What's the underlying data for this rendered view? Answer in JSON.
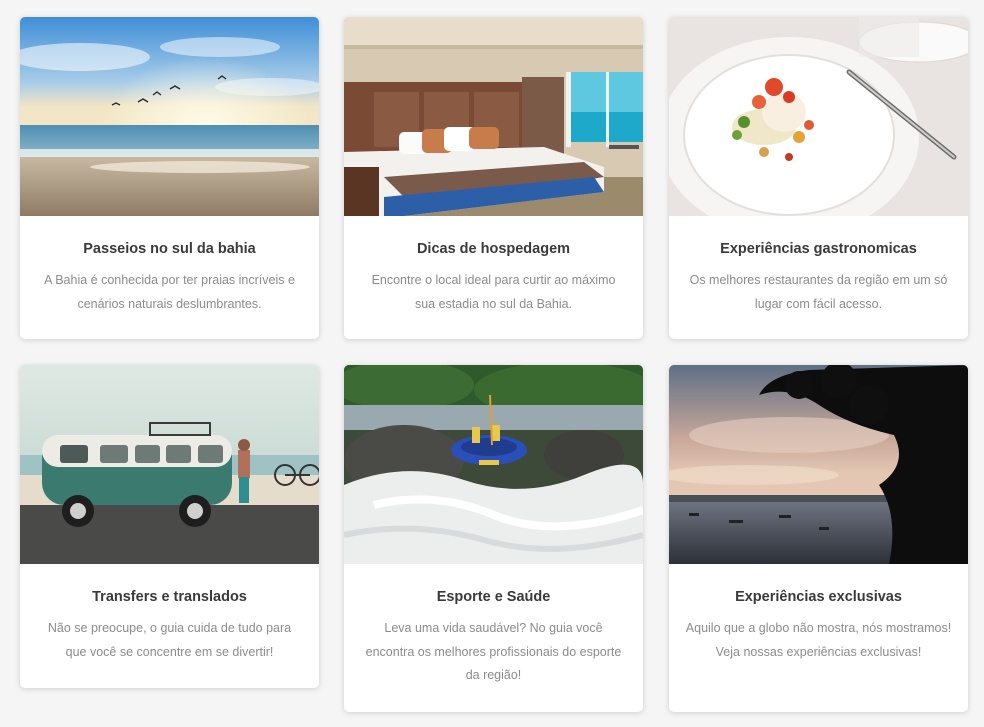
{
  "cards": [
    {
      "title": "Passeios no sul da bahia",
      "description": "A Bahia é conhecida por ter praias incríveis e cenários naturais deslumbrantes."
    },
    {
      "title": "Dicas de hospedagem",
      "description": "Encontre o local ideal para curtir ao máximo sua estadia no sul da Bahia."
    },
    {
      "title": "Experiências gastronomicas",
      "description": "Os melhores restaurantes da região em um só lugar com fácil acesso."
    },
    {
      "title": "Transfers e translados",
      "description": "Não se preocupe, o guia cuida de tudo para que você se concentre em se divertir!"
    },
    {
      "title": "Esporte e Saúde",
      "description": "Leva uma vida saudável? No guia você encontra os melhores profissionais do esporte da região!"
    },
    {
      "title": "Experiências exclusivas",
      "description": "Aquilo que a globo não mostra, nós mostramos! Veja nossas experiências exclusivas!"
    }
  ],
  "colors": {
    "page_background": "#f5f5f5",
    "card_background": "#ffffff",
    "title_text": "#3a3a3a",
    "description_text": "#8c8c8c"
  }
}
